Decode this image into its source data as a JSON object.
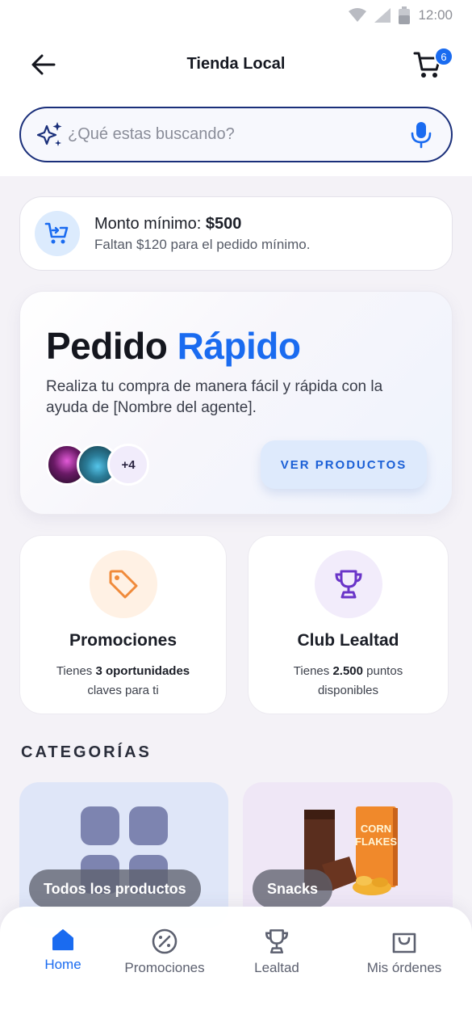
{
  "status_bar": {
    "time": "12:00"
  },
  "header": {
    "title": "Tienda Local",
    "cart_count": "6"
  },
  "search": {
    "placeholder": "¿Qué estas buscando?"
  },
  "minimum": {
    "label": "Monto mínimo:",
    "amount": "$500",
    "subtitle": "Faltan $120 para el pedido mínimo."
  },
  "quick_order": {
    "title_part1": "Pedido",
    "title_part2": "Rápido",
    "description": "Realiza tu compra de manera fácil y rápida con la ayuda de [Nombre del agente].",
    "extra_count": "+4",
    "button": "VER PRODUCTOS"
  },
  "promotions": {
    "title": "Promociones",
    "desc_prefix": "Tienes",
    "desc_bold": "3 oportunidades",
    "desc_suffix": "claves para ti"
  },
  "club": {
    "title": "Club Lealtad",
    "desc_prefix": "Tienes",
    "desc_bold": "2.500",
    "desc_suffix": "puntos disponibles"
  },
  "categories": {
    "heading": "CATEGORÍAS",
    "items": [
      {
        "label": "Todos los productos"
      },
      {
        "label": "Snacks"
      }
    ]
  },
  "bottom_nav": {
    "items": [
      {
        "label": "Home",
        "active": true
      },
      {
        "label": "Promociones",
        "active": false
      },
      {
        "label": "Lealtad",
        "active": false
      },
      {
        "label": "Mis órdenes",
        "active": false
      }
    ]
  },
  "colors": {
    "accent": "#1a6bf0",
    "navy": "#1a2f7a",
    "promo_orange": "#f08a3a",
    "club_purple": "#6a35c8"
  }
}
